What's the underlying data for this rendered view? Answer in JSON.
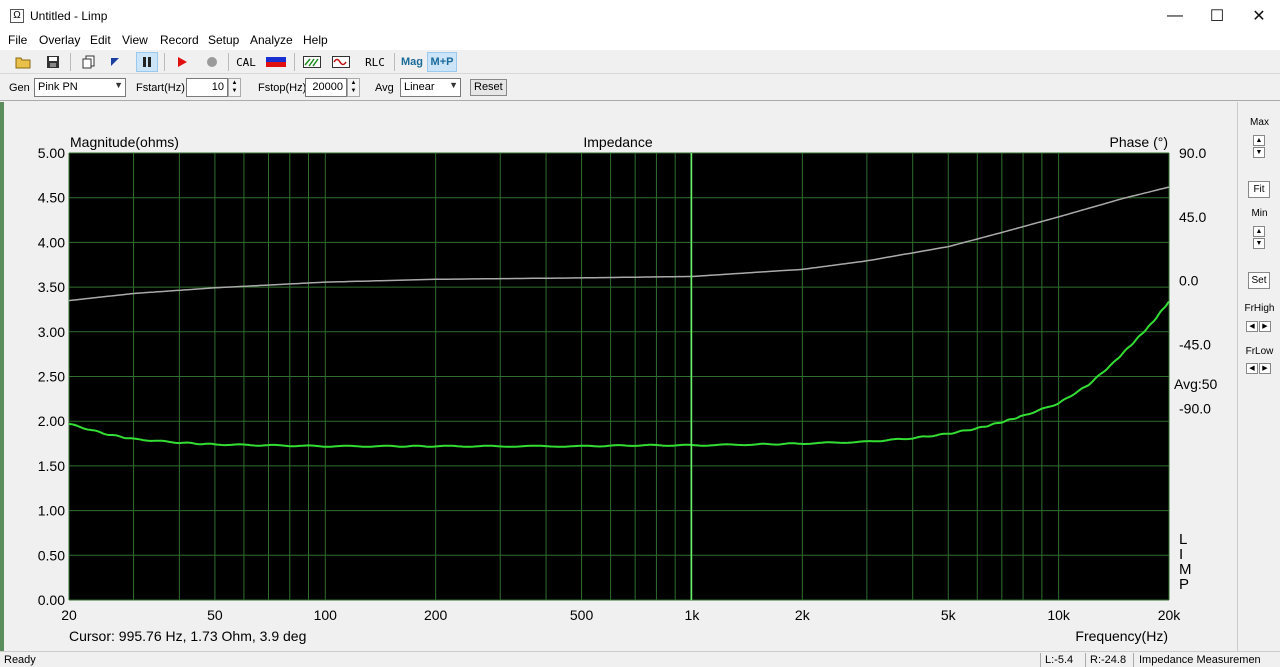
{
  "window": {
    "title": "Untitled - Limp",
    "app_icon": "Ω"
  },
  "menu": [
    "File",
    "Overlay",
    "Edit",
    "View",
    "Record",
    "Setup",
    "Analyze",
    "Help"
  ],
  "toolbar": {
    "cal_label": "CAL",
    "rlc_label": "RLC",
    "mag_label": "Mag",
    "mp_label": "M+P"
  },
  "gen": {
    "gen_label": "Gen",
    "gen_value": "Pink PN",
    "fstart_label": "Fstart(Hz)",
    "fstart_value": "10",
    "fstop_label": "Fstop(Hz)",
    "fstop_value": "20000",
    "avg_label": "Avg",
    "avg_value": "Linear",
    "reset_label": "Reset"
  },
  "side": {
    "max": "Max",
    "fit": "Fit",
    "min": "Min",
    "set": "Set",
    "frhigh": "FrHigh",
    "frlow": "FrLow"
  },
  "chart_data": {
    "type": "line",
    "title": "Impedance",
    "ylabel_left": "Magnitude(ohms)",
    "ylabel_right": "Phase (°)",
    "xlabel": "Frequency(Hz)",
    "x_scale": "log",
    "xlim": [
      20,
      20000
    ],
    "ylim_left": [
      0,
      5
    ],
    "ylim_right": [
      -225,
      90
    ],
    "x_ticks": [
      20,
      50,
      100,
      200,
      500,
      1000,
      2000,
      5000,
      10000,
      20000
    ],
    "x_tick_labels": [
      "20",
      "50",
      "100",
      "200",
      "500",
      "1k",
      "2k",
      "5k",
      "10k",
      "20k"
    ],
    "y_ticks_left": [
      "0.00",
      "0.50",
      "1.00",
      "1.50",
      "2.00",
      "2.50",
      "3.00",
      "3.50",
      "4.00",
      "4.50",
      "5.00"
    ],
    "y_ticks_right": [
      "90.0",
      "45.0",
      "0.0",
      "-45.0",
      "-90.0"
    ],
    "avg_text": "Avg:50",
    "side_text": [
      "L",
      "I",
      "M",
      "P"
    ],
    "cursor_frequency": 995.76,
    "cursor_text": "Cursor: 995.76 Hz, 1.73 Ohm, 3.9 deg",
    "grid": true,
    "colors": {
      "background": "#000000",
      "grid": "#2f6f2f",
      "magnitude": "#33dd33",
      "phase": "#aaaaaa",
      "cursor": "#66ee66"
    },
    "series": [
      {
        "name": "Magnitude",
        "axis": "left",
        "x": [
          20,
          25,
          30,
          40,
          50,
          70,
          100,
          150,
          200,
          300,
          500,
          700,
          1000,
          1500,
          2000,
          3000,
          4000,
          5000,
          6000,
          7000,
          8000,
          10000,
          12000,
          14000,
          16000,
          18000,
          20000
        ],
        "y": [
          1.97,
          1.86,
          1.8,
          1.76,
          1.74,
          1.73,
          1.72,
          1.72,
          1.72,
          1.72,
          1.72,
          1.73,
          1.73,
          1.74,
          1.75,
          1.77,
          1.81,
          1.86,
          1.92,
          1.99,
          2.06,
          2.2,
          2.4,
          2.64,
          2.88,
          3.1,
          3.34
        ]
      },
      {
        "name": "Phase",
        "axis": "right",
        "x": [
          20,
          30,
          50,
          100,
          200,
          500,
          1000,
          2000,
          3000,
          5000,
          7000,
          10000,
          15000,
          20000
        ],
        "y": [
          -14,
          -9,
          -5,
          -1,
          1,
          2,
          3,
          8,
          14,
          24,
          34,
          45,
          58,
          66
        ]
      }
    ]
  },
  "status": {
    "ready": "Ready",
    "l": "L:-5.4",
    "r": "R:-24.8",
    "mode": "Impedance Measuremen"
  }
}
